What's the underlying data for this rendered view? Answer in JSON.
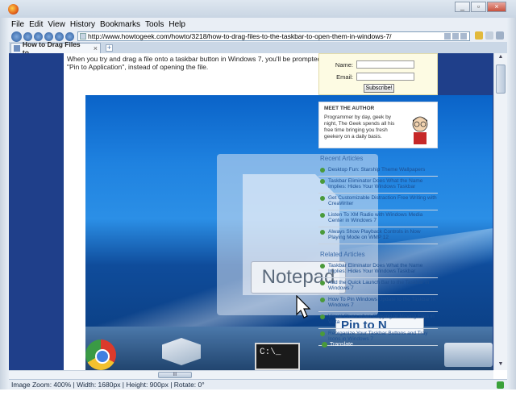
{
  "menu": [
    "File",
    "Edit",
    "View",
    "History",
    "Bookmarks",
    "Tools",
    "Help"
  ],
  "url": "http://www.howtogeek.com/howto/3218/how-to-drag-files-to-the-taskbar-to-open-them-in-windows-7/",
  "tab": {
    "title": "How to Drag Files to...",
    "close": "×",
    "new": "+"
  },
  "window_buttons": {
    "minimize": "_",
    "restore": "▫",
    "close": "×"
  },
  "page": {
    "intro": "When you try and drag a file onto a taskbar button in Windows 7, you'll be prompted to \"Pin to Application\", instead of opening the file."
  },
  "subscribe": {
    "name_label": "Name:",
    "email_label": "Email:",
    "button": "Subscribe!"
  },
  "author": {
    "title": "MEET THE AUTHOR",
    "bio": "Programmer by day, geek by night, The Geek spends all his free time bringing you fresh geekery on a daily basis."
  },
  "recent_title": "Recent Articles",
  "recent": [
    "Desktop Fun: Starship Theme Wallpapers",
    "Taskbar Eliminator Does What the Name Implies: Hides Your Windows Taskbar",
    "Get Customizable Distraction Free Writing with CreaWriter",
    "Listen To XM Radio with Windows Media Center in Windows 7",
    "Always Show Playback Controls in Now Playing Mode on WMP 12"
  ],
  "related_title": "Related Articles",
  "related": [
    "Taskbar Eliminator Does What the Name Implies: Hides Your Windows Taskbar",
    "Add the Quick Launch Bar to the Taskbar in Windows 7",
    "How To Pin Windows Update to the Taskbar in Windows 7",
    "Visual Clues when Copying or Moving Files in Vista",
    "Reorganize Your Taskbar Buttons and Tray Icons in Windows 7"
  ],
  "translate": "Translate",
  "screenshot": {
    "cmd_prompt": "C:\\_",
    "drag_label": "Notepad",
    "pin_tooltip": "Pin to N"
  },
  "hscroll_grip": "III",
  "status": "Image Zoom: 400% | Width: 1680px | Height: 900px | Rotate: 0°",
  "colors": {
    "page_bg": "#1f3f8a",
    "accent": "#3a6aa8",
    "subscribe_bg": "#fdfbe3"
  }
}
